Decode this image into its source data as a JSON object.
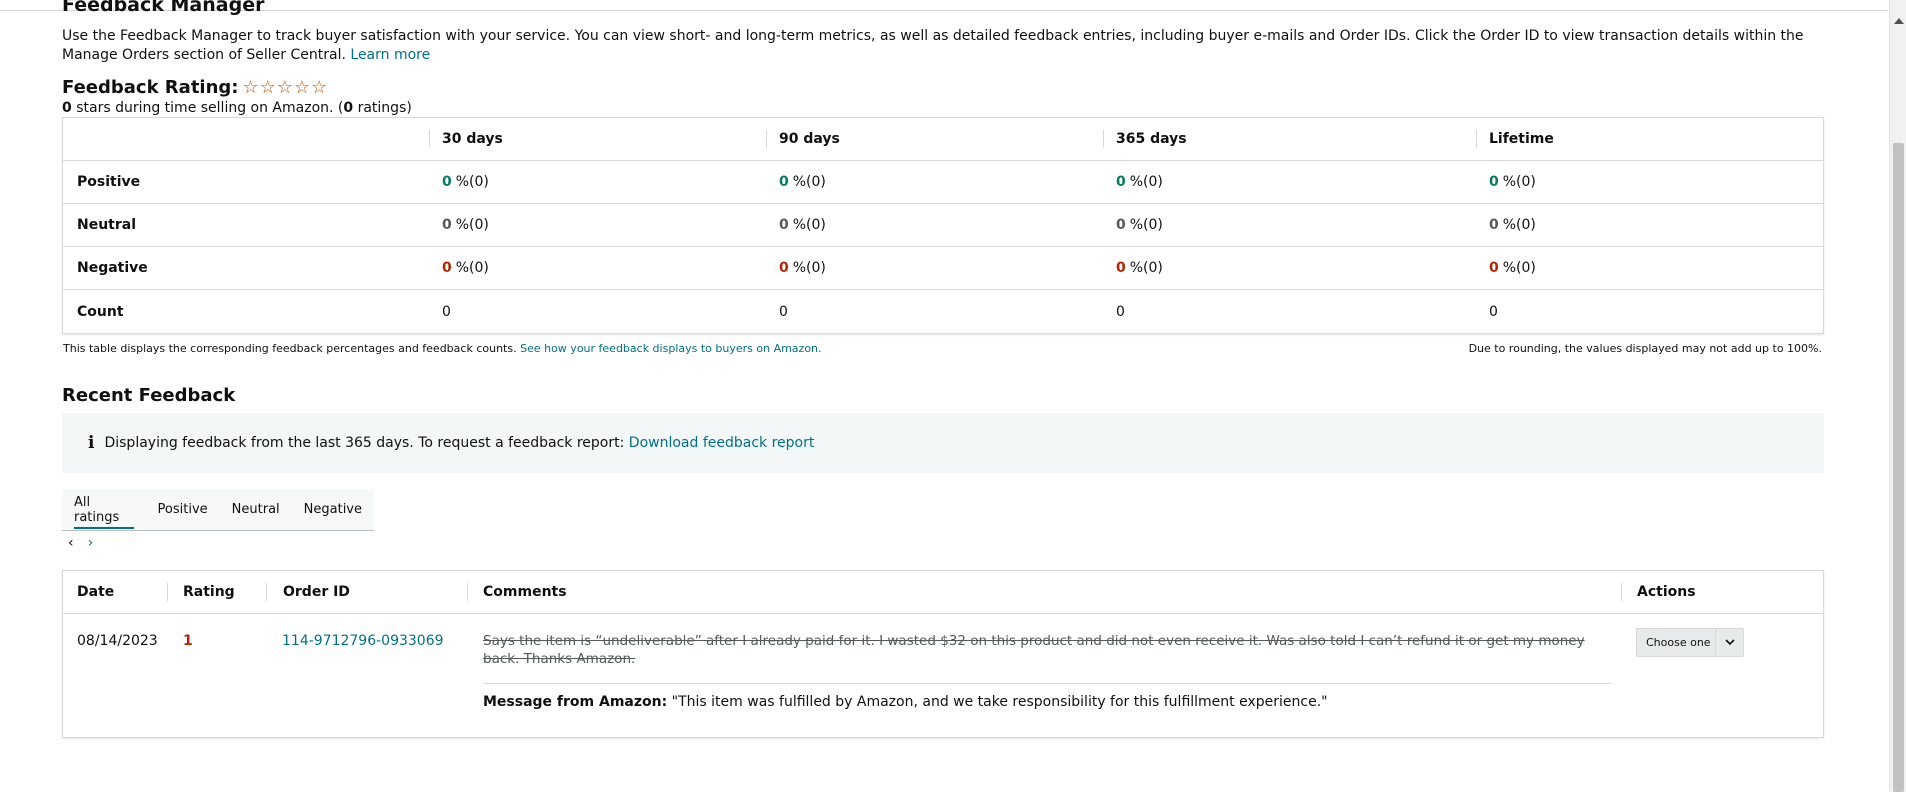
{
  "header": {
    "title": "Feedback Manager",
    "intro": "Use the Feedback Manager to track buyer satisfaction with your service. You can view short- and long-term metrics, as well as detailed feedback entries, including buyer e-mails and Order IDs. Click the Order ID to view transaction details within the Manage Orders section of Seller Central.",
    "learn_more": "Learn more"
  },
  "rating": {
    "heading": "Feedback Rating:",
    "stars_filled": 0,
    "stars_total": 5,
    "stars_value": "0",
    "sub_text_1": " stars during time selling on Amazon. (",
    "ratings_count": "0",
    "sub_text_2": " ratings)"
  },
  "metrics": {
    "columns": [
      "30 days",
      "90 days",
      "365 days",
      "Lifetime"
    ],
    "rows": [
      {
        "label": "Positive",
        "values": [
          {
            "pct": "0",
            "count": "%(0)"
          },
          {
            "pct": "0",
            "count": "%(0)"
          },
          {
            "pct": "0",
            "count": "%(0)"
          },
          {
            "pct": "0",
            "count": "%(0)"
          }
        ]
      },
      {
        "label": "Neutral",
        "values": [
          {
            "pct": "0",
            "count": "%(0)"
          },
          {
            "pct": "0",
            "count": "%(0)"
          },
          {
            "pct": "0",
            "count": "%(0)"
          },
          {
            "pct": "0",
            "count": "%(0)"
          }
        ]
      },
      {
        "label": "Negative",
        "values": [
          {
            "pct": "0",
            "count": "%(0)"
          },
          {
            "pct": "0",
            "count": "%(0)"
          },
          {
            "pct": "0",
            "count": "%(0)"
          },
          {
            "pct": "0",
            "count": "%(0)"
          }
        ]
      },
      {
        "label": "Count",
        "values": [
          "0",
          "0",
          "0",
          "0"
        ]
      }
    ],
    "note": "This table displays the corresponding feedback percentages and feedback counts.",
    "note_link": "See how your feedback displays to buyers on Amazon.",
    "note_right": "Due to rounding, the values displayed may not add up to 100%."
  },
  "recent": {
    "title": "Recent Feedback",
    "info_text": "Displaying feedback from the last 365 days. To request a feedback report:",
    "info_link": "Download feedback report",
    "tabs": [
      "All ratings",
      "Positive",
      "Neutral",
      "Negative"
    ],
    "active_tab": 0,
    "pager_prev": "‹",
    "pager_next": "›",
    "columns": {
      "date": "Date",
      "rating": "Rating",
      "order_id": "Order ID",
      "comments": "Comments",
      "actions": "Actions"
    },
    "entry": {
      "date": "08/14/2023",
      "rating": "1",
      "order_id": "114-9712796-0933069",
      "comment": "Says the item is “undeliverable” after I already paid for it. I wasted $32 on this product and did not even receive it. Was also told I can’t refund it or get my money back. Thanks Amazon.",
      "amazon_label": "Message from Amazon:",
      "amazon_message": "\"This item was fulfilled by Amazon, and we take responsibility for this fulfillment experience.\"",
      "action_label": "Choose one"
    }
  },
  "colors": {
    "link": "#007185",
    "positive": "#067d62",
    "negative": "#b12704",
    "neutral": "#565959"
  }
}
